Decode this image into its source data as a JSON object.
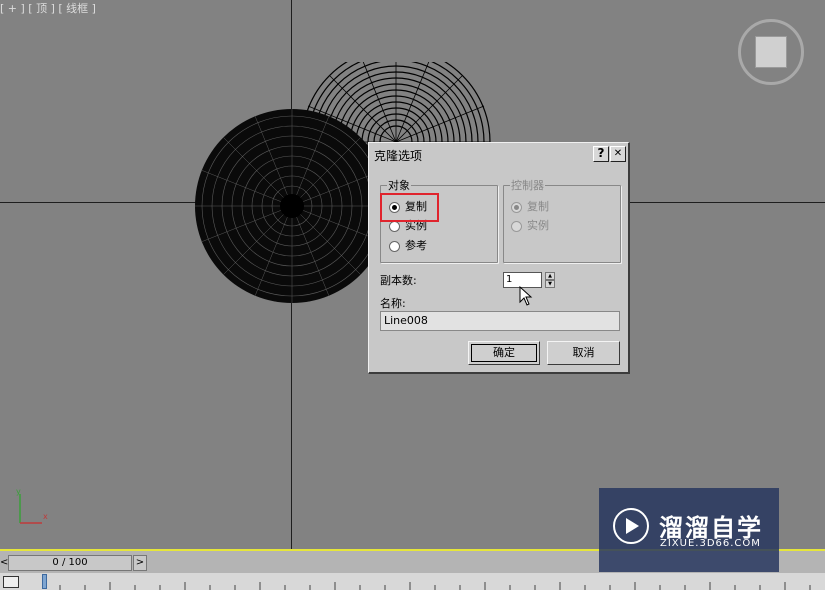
{
  "viewport": {
    "label": "[ + ] [ 顶 ] [ 线框 ]"
  },
  "dialog": {
    "title": "克隆选项",
    "help_label": "?",
    "close_label": "✕",
    "object_group": {
      "legend": "对象",
      "options": [
        "复制",
        "实例",
        "参考"
      ],
      "selected": "复制"
    },
    "controller_group": {
      "legend": "控制器",
      "options": [
        "复制",
        "实例"
      ],
      "selected": "复制",
      "disabled": true
    },
    "copies_label": "副本数:",
    "copies_value": "1",
    "name_label": "名称:",
    "name_value": "Line008",
    "ok_label": "确定",
    "cancel_label": "取消"
  },
  "gizmo": {
    "y_label": "y",
    "x_label": "x"
  },
  "timeline": {
    "frame_display": "0 / 100",
    "prev_label": "<",
    "next_label": ">"
  },
  "watermark": {
    "title": "溜溜自学",
    "url": "ZIXUE.3D66.COM"
  },
  "colors": {
    "viewport_bg": "#828282",
    "dialog_bg": "#c8c8c8",
    "highlight": "#e0242d",
    "timeline_accent": "#e6e63a",
    "watermark_bg": "#283760"
  }
}
